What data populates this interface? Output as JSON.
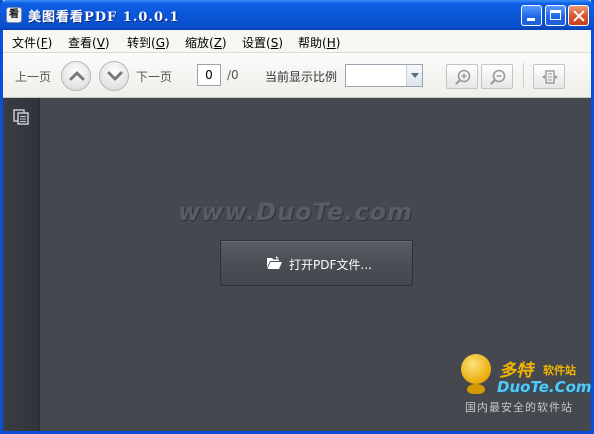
{
  "window": {
    "title": "美图看看PDF  1.0.0.1",
    "app_icon_glyph": "看"
  },
  "menu": {
    "items": [
      {
        "label": "文件(",
        "key": "F",
        "tail": ")"
      },
      {
        "label": "查看(",
        "key": "V",
        "tail": ")"
      },
      {
        "label": "转到(",
        "key": "G",
        "tail": ")"
      },
      {
        "label": "缩放(",
        "key": "Z",
        "tail": ")"
      },
      {
        "label": "设置(",
        "key": "S",
        "tail": ")"
      },
      {
        "label": "帮助(",
        "key": "H",
        "tail": ")"
      }
    ],
    "overflow": "»"
  },
  "toolbar": {
    "prev_label": "上一页",
    "next_label": "下一页",
    "page_current": "0",
    "page_total": "/0",
    "zoom_label": "当前显示比例",
    "zoom_value": ""
  },
  "main": {
    "watermark": "www.DuoTe.com",
    "open_button_label": "打开PDF文件..."
  },
  "corner_logo": {
    "brand_cn": "多特",
    "brand_small": "软件站",
    "brand_en": "DuoTe.Com",
    "tagline": "国内最安全的软件站"
  },
  "colors": {
    "titlebar": "#0a55d6",
    "canvas": "#45484f",
    "sidebar": "#33363d",
    "logo_gold": "#f2b400",
    "logo_blue": "#58c8f0"
  }
}
